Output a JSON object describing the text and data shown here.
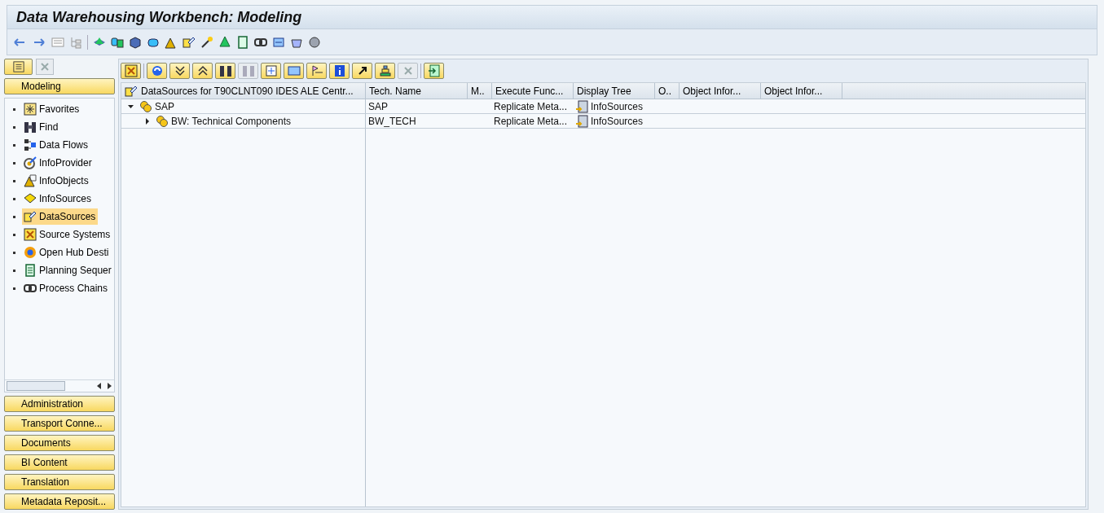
{
  "window": {
    "title": "Data Warehousing Workbench: Modeling"
  },
  "navigator": {
    "active_section": "Modeling",
    "items": [
      {
        "label": "Favorites",
        "selected": false
      },
      {
        "label": "Find",
        "selected": false
      },
      {
        "label": "Data Flows",
        "selected": false
      },
      {
        "label": "InfoProvider",
        "selected": false
      },
      {
        "label": "InfoObjects",
        "selected": false
      },
      {
        "label": "InfoSources",
        "selected": false
      },
      {
        "label": "DataSources",
        "selected": true
      },
      {
        "label": "Source Systems",
        "selected": false
      },
      {
        "label": "Open Hub Desti",
        "selected": false
      },
      {
        "label": "Planning Sequer",
        "selected": false
      },
      {
        "label": "Process Chains",
        "selected": false
      }
    ],
    "sections": [
      "Administration",
      "Transport Conne...",
      "Documents",
      "BI Content",
      "Translation",
      "Metadata Reposit..."
    ]
  },
  "table": {
    "columns": [
      "DataSources for T90CLNT090 IDES ALE Centr...",
      "Tech. Name",
      "M..",
      "Execute Func...",
      "Display Tree",
      "O..",
      "Object Infor...",
      "Object Infor..."
    ],
    "rows": [
      {
        "name": "SAP",
        "tech_name": "SAP",
        "execute": "Replicate Meta...",
        "display_tree": "InfoSources",
        "expanded": true,
        "children": [
          {
            "name": "BW: Technical Components",
            "tech_name": "BW_TECH",
            "execute": "Replicate Meta...",
            "display_tree": "InfoSources",
            "expanded": false
          }
        ]
      }
    ]
  }
}
